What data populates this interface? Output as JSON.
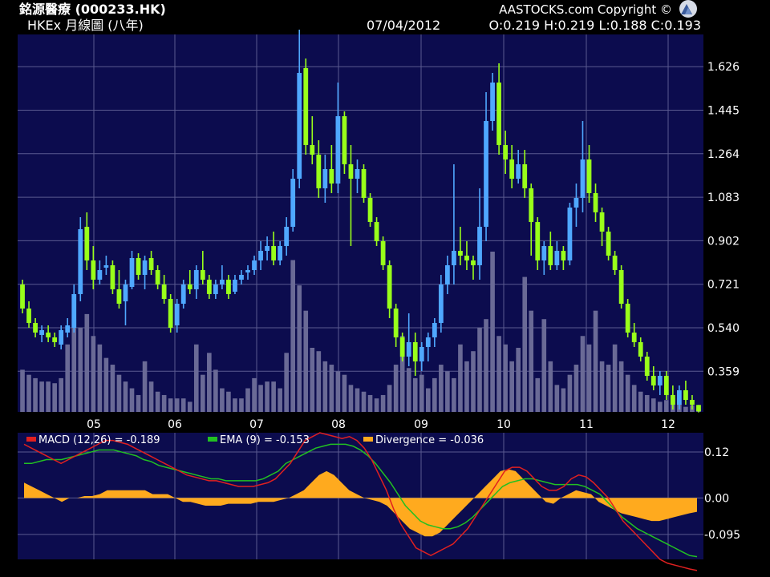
{
  "header": {
    "title": "銘源醫療 (000233.HK)",
    "subtitle": "HKEx 月線圖 (八年)",
    "copyright": "AASTOCKS.com Copyright ©",
    "date": "07/04/2012",
    "ohlc": "O:0.219 H:0.219 L:0.188 C:0.193"
  },
  "colors": {
    "background": "#000000",
    "plot_bg": "#0c0c4e",
    "grid": "#5a5a90",
    "up": "#4fa8ff",
    "down": "#99ff1a",
    "volume": "#6a6a96",
    "macd": "#e02020",
    "ema": "#22c022",
    "divergence": "#ffaa1e"
  },
  "chart_data": [
    {
      "type": "candlestick",
      "title": "",
      "x_labels": [
        "05",
        "06",
        "07",
        "08",
        "09",
        "10",
        "11",
        "12"
      ],
      "y_ticks": [
        0.359,
        0.54,
        0.721,
        0.902,
        1.083,
        1.264,
        1.445,
        1.626
      ],
      "ylim": [
        0.19,
        1.76
      ],
      "grid": true,
      "candles": [
        [
          0.72,
          0.74,
          0.6,
          0.62
        ],
        [
          0.62,
          0.65,
          0.54,
          0.56
        ],
        [
          0.56,
          0.58,
          0.5,
          0.52
        ],
        [
          0.51,
          0.55,
          0.48,
          0.53
        ],
        [
          0.52,
          0.55,
          0.48,
          0.5
        ],
        [
          0.5,
          0.52,
          0.46,
          0.48
        ],
        [
          0.47,
          0.55,
          0.45,
          0.53
        ],
        [
          0.52,
          0.58,
          0.5,
          0.55
        ],
        [
          0.54,
          0.72,
          0.52,
          0.68
        ],
        [
          0.68,
          1.0,
          0.65,
          0.95
        ],
        [
          0.96,
          1.02,
          0.78,
          0.82
        ],
        [
          0.82,
          0.88,
          0.7,
          0.74
        ],
        [
          0.74,
          0.82,
          0.72,
          0.78
        ],
        [
          0.79,
          0.84,
          0.76,
          0.8
        ],
        [
          0.8,
          0.82,
          0.68,
          0.7
        ],
        [
          0.7,
          0.78,
          0.62,
          0.64
        ],
        [
          0.65,
          0.74,
          0.55,
          0.72
        ],
        [
          0.71,
          0.86,
          0.7,
          0.83
        ],
        [
          0.83,
          0.85,
          0.74,
          0.76
        ],
        [
          0.76,
          0.84,
          0.7,
          0.82
        ],
        [
          0.83,
          0.86,
          0.76,
          0.78
        ],
        [
          0.78,
          0.8,
          0.7,
          0.72
        ],
        [
          0.72,
          0.76,
          0.64,
          0.66
        ],
        [
          0.66,
          0.68,
          0.52,
          0.54
        ],
        [
          0.55,
          0.66,
          0.52,
          0.64
        ],
        [
          0.64,
          0.74,
          0.62,
          0.72
        ],
        [
          0.72,
          0.78,
          0.68,
          0.7
        ],
        [
          0.7,
          0.8,
          0.66,
          0.78
        ],
        [
          0.78,
          0.86,
          0.72,
          0.74
        ],
        [
          0.74,
          0.76,
          0.66,
          0.68
        ],
        [
          0.68,
          0.74,
          0.66,
          0.72
        ],
        [
          0.72,
          0.8,
          0.7,
          0.74
        ],
        [
          0.74,
          0.76,
          0.66,
          0.68
        ],
        [
          0.69,
          0.76,
          0.68,
          0.74
        ],
        [
          0.74,
          0.78,
          0.72,
          0.76
        ],
        [
          0.77,
          0.8,
          0.74,
          0.78
        ],
        [
          0.78,
          0.84,
          0.76,
          0.82
        ],
        [
          0.82,
          0.9,
          0.78,
          0.86
        ],
        [
          0.86,
          0.92,
          0.82,
          0.88
        ],
        [
          0.88,
          0.94,
          0.8,
          0.82
        ],
        [
          0.82,
          0.9,
          0.8,
          0.88
        ],
        [
          0.88,
          1.0,
          0.84,
          0.96
        ],
        [
          0.96,
          1.2,
          0.94,
          1.16
        ],
        [
          1.16,
          1.78,
          1.12,
          1.6
        ],
        [
          1.62,
          1.66,
          1.26,
          1.3
        ],
        [
          1.3,
          1.42,
          1.22,
          1.26
        ],
        [
          1.26,
          1.32,
          1.08,
          1.12
        ],
        [
          1.12,
          1.26,
          1.06,
          1.2
        ],
        [
          1.2,
          1.3,
          1.1,
          1.14
        ],
        [
          1.14,
          1.56,
          1.1,
          1.42
        ],
        [
          1.42,
          1.44,
          1.18,
          1.22
        ],
        [
          1.22,
          1.3,
          0.88,
          1.16
        ],
        [
          1.16,
          1.24,
          1.1,
          1.2
        ],
        [
          1.2,
          1.22,
          1.06,
          1.08
        ],
        [
          1.08,
          1.1,
          0.96,
          0.98
        ],
        [
          0.98,
          1.0,
          0.88,
          0.9
        ],
        [
          0.9,
          0.92,
          0.78,
          0.8
        ],
        [
          0.8,
          0.82,
          0.58,
          0.62
        ],
        [
          0.62,
          0.64,
          0.46,
          0.5
        ],
        [
          0.5,
          0.52,
          0.4,
          0.42
        ],
        [
          0.42,
          0.6,
          0.38,
          0.48
        ],
        [
          0.48,
          0.52,
          0.34,
          0.4
        ],
        [
          0.4,
          0.48,
          0.36,
          0.46
        ],
        [
          0.46,
          0.52,
          0.4,
          0.5
        ],
        [
          0.5,
          0.58,
          0.46,
          0.56
        ],
        [
          0.56,
          0.76,
          0.52,
          0.72
        ],
        [
          0.72,
          0.84,
          0.68,
          0.8
        ],
        [
          0.8,
          1.22,
          0.72,
          0.86
        ],
        [
          0.86,
          0.96,
          0.8,
          0.84
        ],
        [
          0.84,
          0.9,
          0.78,
          0.82
        ],
        [
          0.82,
          0.84,
          0.74,
          0.8
        ],
        [
          0.8,
          1.12,
          0.74,
          0.96
        ],
        [
          0.96,
          1.52,
          0.9,
          1.4
        ],
        [
          1.4,
          1.6,
          1.36,
          1.56
        ],
        [
          1.56,
          1.64,
          1.26,
          1.3
        ],
        [
          1.3,
          1.36,
          1.18,
          1.24
        ],
        [
          1.24,
          1.3,
          1.12,
          1.16
        ],
        [
          1.16,
          1.28,
          1.14,
          1.22
        ],
        [
          1.22,
          1.28,
          1.08,
          1.12
        ],
        [
          1.12,
          1.14,
          0.84,
          0.98
        ],
        [
          0.98,
          1.0,
          0.78,
          0.82
        ],
        [
          0.82,
          0.9,
          0.76,
          0.88
        ],
        [
          0.88,
          0.94,
          0.78,
          0.8
        ],
        [
          0.8,
          0.9,
          0.78,
          0.86
        ],
        [
          0.86,
          0.88,
          0.78,
          0.82
        ],
        [
          0.82,
          1.06,
          0.8,
          1.04
        ],
        [
          1.04,
          1.14,
          0.96,
          1.08
        ],
        [
          1.08,
          1.4,
          1.02,
          1.24
        ],
        [
          1.24,
          1.3,
          1.06,
          1.1
        ],
        [
          1.1,
          1.14,
          0.98,
          1.02
        ],
        [
          1.02,
          1.04,
          0.88,
          0.94
        ],
        [
          0.94,
          0.96,
          0.82,
          0.84
        ],
        [
          0.84,
          0.86,
          0.76,
          0.78
        ],
        [
          0.78,
          0.8,
          0.62,
          0.64
        ],
        [
          0.64,
          0.66,
          0.5,
          0.52
        ],
        [
          0.52,
          0.56,
          0.46,
          0.48
        ],
        [
          0.48,
          0.5,
          0.4,
          0.42
        ],
        [
          0.42,
          0.44,
          0.32,
          0.34
        ],
        [
          0.34,
          0.38,
          0.28,
          0.3
        ],
        [
          0.3,
          0.36,
          0.26,
          0.34
        ],
        [
          0.34,
          0.36,
          0.24,
          0.26
        ],
        [
          0.26,
          0.3,
          0.2,
          0.22
        ],
        [
          0.22,
          0.3,
          0.2,
          0.28
        ],
        [
          0.28,
          0.32,
          0.22,
          0.24
        ],
        [
          0.24,
          0.26,
          0.2,
          0.22
        ],
        [
          0.219,
          0.219,
          0.188,
          0.193
        ]
      ],
      "volume": [
        25,
        22,
        20,
        18,
        18,
        17,
        20,
        40,
        55,
        50,
        58,
        45,
        40,
        32,
        28,
        22,
        18,
        14,
        10,
        30,
        18,
        12,
        10,
        8,
        8,
        8,
        6,
        40,
        22,
        35,
        25,
        14,
        12,
        8,
        8,
        14,
        20,
        16,
        18,
        18,
        14,
        35,
        90,
        75,
        60,
        38,
        36,
        30,
        28,
        24,
        22,
        16,
        14,
        12,
        10,
        8,
        10,
        16,
        28,
        45,
        26,
        20,
        22,
        14,
        20,
        28,
        24,
        20,
        40,
        30,
        36,
        50,
        55,
        95,
        45,
        40,
        30,
        38,
        80,
        60,
        20,
        55,
        30,
        16,
        14,
        22,
        28,
        45,
        40,
        60,
        30,
        28,
        40,
        30,
        22,
        16,
        12,
        10,
        8,
        6,
        7,
        8,
        5,
        3,
        4,
        2,
        2
      ]
    },
    {
      "type": "line",
      "legend": [
        {
          "series": "macd",
          "label": "MACD (12,26) = -0.189"
        },
        {
          "series": "ema",
          "label": "EMA (9) = -0.153"
        },
        {
          "series": "divergence",
          "label": "Divergence = -0.036"
        }
      ],
      "y_ticks": [
        0.12,
        0.0,
        -0.095
      ],
      "ylim": [
        -0.16,
        0.17
      ],
      "macd": [
        0.14,
        0.13,
        0.12,
        0.11,
        0.1,
        0.09,
        0.1,
        0.11,
        0.12,
        0.13,
        0.14,
        0.15,
        0.15,
        0.145,
        0.14,
        0.13,
        0.12,
        0.11,
        0.1,
        0.09,
        0.08,
        0.07,
        0.06,
        0.055,
        0.05,
        0.045,
        0.045,
        0.04,
        0.035,
        0.03,
        0.03,
        0.03,
        0.035,
        0.04,
        0.05,
        0.07,
        0.09,
        0.12,
        0.15,
        0.16,
        0.17,
        0.165,
        0.16,
        0.155,
        0.16,
        0.15,
        0.13,
        0.1,
        0.06,
        0.02,
        -0.03,
        -0.07,
        -0.1,
        -0.13,
        -0.14,
        -0.15,
        -0.14,
        -0.13,
        -0.12,
        -0.1,
        -0.08,
        -0.05,
        -0.02,
        0.01,
        0.04,
        0.07,
        0.08,
        0.08,
        0.07,
        0.05,
        0.03,
        0.02,
        0.02,
        0.03,
        0.05,
        0.06,
        0.055,
        0.04,
        0.02,
        0.0,
        -0.03,
        -0.06,
        -0.08,
        -0.1,
        -0.12,
        -0.14,
        -0.16,
        -0.17,
        -0.175,
        -0.18,
        -0.185,
        -0.189
      ],
      "ema": [
        0.09,
        0.09,
        0.095,
        0.1,
        0.1,
        0.1,
        0.105,
        0.11,
        0.115,
        0.12,
        0.125,
        0.125,
        0.125,
        0.12,
        0.115,
        0.11,
        0.1,
        0.095,
        0.085,
        0.08,
        0.075,
        0.07,
        0.065,
        0.06,
        0.055,
        0.05,
        0.05,
        0.045,
        0.045,
        0.045,
        0.045,
        0.045,
        0.05,
        0.06,
        0.07,
        0.09,
        0.1,
        0.11,
        0.12,
        0.13,
        0.135,
        0.14,
        0.14,
        0.14,
        0.135,
        0.125,
        0.11,
        0.09,
        0.065,
        0.04,
        0.01,
        -0.02,
        -0.04,
        -0.06,
        -0.07,
        -0.075,
        -0.08,
        -0.08,
        -0.075,
        -0.065,
        -0.05,
        -0.03,
        -0.01,
        0.01,
        0.03,
        0.04,
        0.045,
        0.05,
        0.05,
        0.045,
        0.04,
        0.035,
        0.035,
        0.035,
        0.035,
        0.03,
        0.02,
        0.01,
        -0.01,
        -0.03,
        -0.05,
        -0.065,
        -0.08,
        -0.09,
        -0.1,
        -0.11,
        -0.12,
        -0.13,
        -0.14,
        -0.15,
        -0.153
      ],
      "divergence": [
        0.04,
        0.03,
        0.02,
        0.01,
        0.0,
        -0.01,
        0.0,
        0.0,
        0.005,
        0.005,
        0.01,
        0.02,
        0.02,
        0.02,
        0.02,
        0.02,
        0.02,
        0.01,
        0.01,
        0.01,
        0.0,
        -0.01,
        -0.01,
        -0.015,
        -0.02,
        -0.02,
        -0.02,
        -0.015,
        -0.015,
        -0.015,
        -0.015,
        -0.01,
        -0.01,
        -0.01,
        -0.005,
        0.0,
        0.01,
        0.02,
        0.04,
        0.06,
        0.07,
        0.06,
        0.04,
        0.02,
        0.01,
        0.0,
        -0.005,
        -0.01,
        -0.02,
        -0.04,
        -0.06,
        -0.08,
        -0.09,
        -0.1,
        -0.1,
        -0.09,
        -0.07,
        -0.05,
        -0.03,
        -0.01,
        0.01,
        0.03,
        0.05,
        0.07,
        0.075,
        0.07,
        0.05,
        0.03,
        0.01,
        -0.01,
        -0.015,
        0.0,
        0.01,
        0.02,
        0.015,
        0.01,
        -0.01,
        -0.02,
        -0.03,
        -0.04,
        -0.045,
        -0.05,
        -0.055,
        -0.06,
        -0.06,
        -0.055,
        -0.05,
        -0.045,
        -0.04,
        -0.036
      ]
    }
  ]
}
